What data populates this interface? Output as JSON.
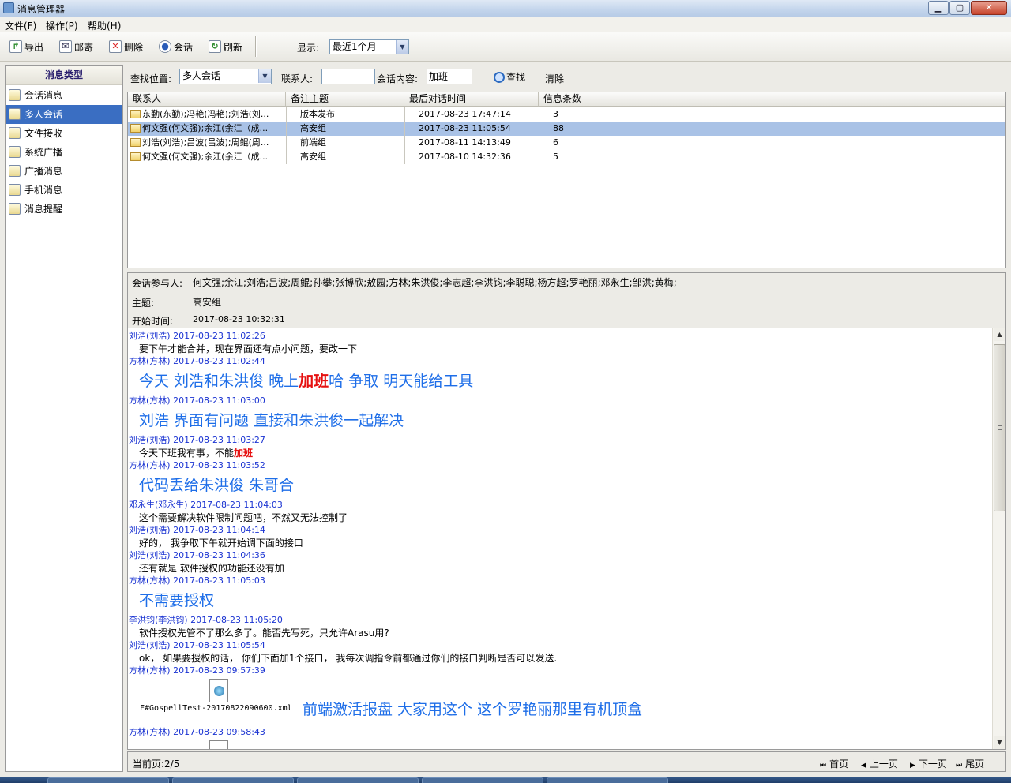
{
  "window": {
    "title": "消息管理器"
  },
  "menu": [
    "文件(F)",
    "操作(P)",
    "帮助(H)"
  ],
  "toolbar": {
    "export": "导出",
    "mail": "邮寄",
    "delete": "删除",
    "session": "会话",
    "refresh": "刷新",
    "show_label": "显示:",
    "show_value": "最近1个月"
  },
  "sidebar": {
    "title": "消息类型",
    "items": [
      "会话消息",
      "多人会话",
      "文件接收",
      "系统广播",
      "广播消息",
      "手机消息",
      "消息提醒"
    ]
  },
  "search": {
    "location_label": "查找位置:",
    "location_value": "多人会话",
    "contact_label": "联系人:",
    "contact_value": "",
    "content_label": "会话内容:",
    "content_value": "加班",
    "find": "查找",
    "clear": "清除"
  },
  "grid": {
    "headers": [
      "联系人",
      "备注主题",
      "最后对话时间",
      "信息条数"
    ],
    "rows": [
      {
        "contact": "东勤(东勤);冯艳(冯艳);刘浩(刘...",
        "topic": "版本发布",
        "time": "2017-08-23 17:47:14",
        "count": "3"
      },
      {
        "contact": "何文强(何文强);余江(余江（成...",
        "topic": "高安组",
        "time": "2017-08-23 11:05:54",
        "count": "88"
      },
      {
        "contact": "刘浩(刘浩);吕波(吕波);周鲲(周...",
        "topic": "前端组",
        "time": "2017-08-11 14:13:49",
        "count": "6"
      },
      {
        "contact": "何文强(何文强);余江(余江（成...",
        "topic": "高安组",
        "time": "2017-08-10 14:32:36",
        "count": "5"
      }
    ]
  },
  "info": {
    "participants_label": "会话参与人:",
    "participants": "何文强;余江;刘浩;吕波;周鲲;孙攀;张博欣;敖园;方林;朱洪俊;李志超;李洪钧;李聪聪;杨方超;罗艳丽;邓永生;邹洪;黄梅;",
    "topic_label": "主题:",
    "topic": "高安组",
    "start_label": "开始时间:",
    "start": "2017-08-23 10:32:31"
  },
  "messages": [
    {
      "header": "刘浩(刘浩) 2017-08-23 11:02:26",
      "body": "要下午才能合并，现在界面还有点小问题，要改一下"
    },
    {
      "header": "方林(方林) 2017-08-23 11:02:44",
      "big": true,
      "pre": "今天 刘浩和朱洪俊 晚上",
      "hl": "加班",
      "post": "哈 争取 明天能给工具"
    },
    {
      "header": "方林(方林) 2017-08-23 11:03:00",
      "big": true,
      "body": "刘浩 界面有问题 直接和朱洪俊一起解决"
    },
    {
      "header": "刘浩(刘浩) 2017-08-23 11:03:27",
      "pre": "今天下班我有事，不能",
      "hl": "加班",
      "post": ""
    },
    {
      "header": "方林(方林) 2017-08-23 11:03:52",
      "big": true,
      "body": "代码丢给朱洪俊 朱哥合"
    },
    {
      "header": "邓永生(邓永生) 2017-08-23 11:04:03",
      "body": "这个需要解决软件限制问题吧，不然又无法控制了"
    },
    {
      "header": "刘浩(刘浩) 2017-08-23 11:04:14",
      "body": "好的， 我争取下午就开始调下面的接口"
    },
    {
      "header": "刘浩(刘浩) 2017-08-23 11:04:36",
      "body": "还有就是 软件授权的功能还没有加"
    },
    {
      "header": "方林(方林) 2017-08-23 11:05:03",
      "big": true,
      "body": "不需要授权"
    },
    {
      "header": "李洪钧(李洪钧) 2017-08-23 11:05:20",
      "body": "软件授权先管不了那么多了。能否先写死，只允许Arasu用?"
    },
    {
      "header": "刘浩(刘浩) 2017-08-23 11:05:54",
      "body": "ok， 如果要授权的话， 你们下面加1个接口， 我每次调指令前都通过你们的接口判断是否可以发送."
    },
    {
      "header": "方林(方林) 2017-08-23 09:57:39",
      "attachment": "F#GospellTest-20170822090600.xml",
      "caption": "前端激活报盘 大家用这个 这个罗艳丽那里有机顶盒"
    },
    {
      "header": "方林(方林) 2017-08-23 09:58:43",
      "attachment_partial": true
    }
  ],
  "pager": {
    "current": "当前页:2/5",
    "first": "首页",
    "prev": "上一页",
    "next": "下一页",
    "last": "尾页"
  }
}
